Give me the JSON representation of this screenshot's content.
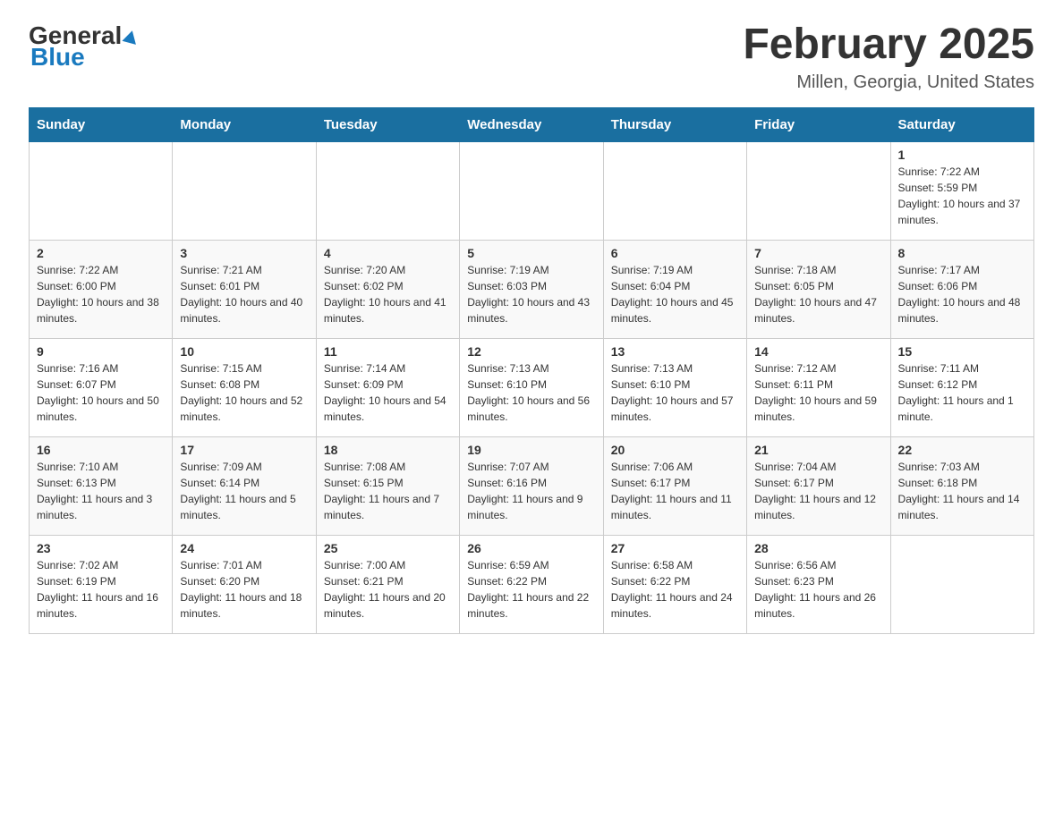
{
  "header": {
    "logo_general": "General",
    "logo_blue": "Blue",
    "month_title": "February 2025",
    "location": "Millen, Georgia, United States"
  },
  "days_of_week": [
    "Sunday",
    "Monday",
    "Tuesday",
    "Wednesday",
    "Thursday",
    "Friday",
    "Saturday"
  ],
  "weeks": [
    {
      "days": [
        {
          "num": "",
          "info": ""
        },
        {
          "num": "",
          "info": ""
        },
        {
          "num": "",
          "info": ""
        },
        {
          "num": "",
          "info": ""
        },
        {
          "num": "",
          "info": ""
        },
        {
          "num": "",
          "info": ""
        },
        {
          "num": "1",
          "info": "Sunrise: 7:22 AM\nSunset: 5:59 PM\nDaylight: 10 hours and 37 minutes."
        }
      ]
    },
    {
      "days": [
        {
          "num": "2",
          "info": "Sunrise: 7:22 AM\nSunset: 6:00 PM\nDaylight: 10 hours and 38 minutes."
        },
        {
          "num": "3",
          "info": "Sunrise: 7:21 AM\nSunset: 6:01 PM\nDaylight: 10 hours and 40 minutes."
        },
        {
          "num": "4",
          "info": "Sunrise: 7:20 AM\nSunset: 6:02 PM\nDaylight: 10 hours and 41 minutes."
        },
        {
          "num": "5",
          "info": "Sunrise: 7:19 AM\nSunset: 6:03 PM\nDaylight: 10 hours and 43 minutes."
        },
        {
          "num": "6",
          "info": "Sunrise: 7:19 AM\nSunset: 6:04 PM\nDaylight: 10 hours and 45 minutes."
        },
        {
          "num": "7",
          "info": "Sunrise: 7:18 AM\nSunset: 6:05 PM\nDaylight: 10 hours and 47 minutes."
        },
        {
          "num": "8",
          "info": "Sunrise: 7:17 AM\nSunset: 6:06 PM\nDaylight: 10 hours and 48 minutes."
        }
      ]
    },
    {
      "days": [
        {
          "num": "9",
          "info": "Sunrise: 7:16 AM\nSunset: 6:07 PM\nDaylight: 10 hours and 50 minutes."
        },
        {
          "num": "10",
          "info": "Sunrise: 7:15 AM\nSunset: 6:08 PM\nDaylight: 10 hours and 52 minutes."
        },
        {
          "num": "11",
          "info": "Sunrise: 7:14 AM\nSunset: 6:09 PM\nDaylight: 10 hours and 54 minutes."
        },
        {
          "num": "12",
          "info": "Sunrise: 7:13 AM\nSunset: 6:10 PM\nDaylight: 10 hours and 56 minutes."
        },
        {
          "num": "13",
          "info": "Sunrise: 7:13 AM\nSunset: 6:10 PM\nDaylight: 10 hours and 57 minutes."
        },
        {
          "num": "14",
          "info": "Sunrise: 7:12 AM\nSunset: 6:11 PM\nDaylight: 10 hours and 59 minutes."
        },
        {
          "num": "15",
          "info": "Sunrise: 7:11 AM\nSunset: 6:12 PM\nDaylight: 11 hours and 1 minute."
        }
      ]
    },
    {
      "days": [
        {
          "num": "16",
          "info": "Sunrise: 7:10 AM\nSunset: 6:13 PM\nDaylight: 11 hours and 3 minutes."
        },
        {
          "num": "17",
          "info": "Sunrise: 7:09 AM\nSunset: 6:14 PM\nDaylight: 11 hours and 5 minutes."
        },
        {
          "num": "18",
          "info": "Sunrise: 7:08 AM\nSunset: 6:15 PM\nDaylight: 11 hours and 7 minutes."
        },
        {
          "num": "19",
          "info": "Sunrise: 7:07 AM\nSunset: 6:16 PM\nDaylight: 11 hours and 9 minutes."
        },
        {
          "num": "20",
          "info": "Sunrise: 7:06 AM\nSunset: 6:17 PM\nDaylight: 11 hours and 11 minutes."
        },
        {
          "num": "21",
          "info": "Sunrise: 7:04 AM\nSunset: 6:17 PM\nDaylight: 11 hours and 12 minutes."
        },
        {
          "num": "22",
          "info": "Sunrise: 7:03 AM\nSunset: 6:18 PM\nDaylight: 11 hours and 14 minutes."
        }
      ]
    },
    {
      "days": [
        {
          "num": "23",
          "info": "Sunrise: 7:02 AM\nSunset: 6:19 PM\nDaylight: 11 hours and 16 minutes."
        },
        {
          "num": "24",
          "info": "Sunrise: 7:01 AM\nSunset: 6:20 PM\nDaylight: 11 hours and 18 minutes."
        },
        {
          "num": "25",
          "info": "Sunrise: 7:00 AM\nSunset: 6:21 PM\nDaylight: 11 hours and 20 minutes."
        },
        {
          "num": "26",
          "info": "Sunrise: 6:59 AM\nSunset: 6:22 PM\nDaylight: 11 hours and 22 minutes."
        },
        {
          "num": "27",
          "info": "Sunrise: 6:58 AM\nSunset: 6:22 PM\nDaylight: 11 hours and 24 minutes."
        },
        {
          "num": "28",
          "info": "Sunrise: 6:56 AM\nSunset: 6:23 PM\nDaylight: 11 hours and 26 minutes."
        },
        {
          "num": "",
          "info": ""
        }
      ]
    }
  ]
}
